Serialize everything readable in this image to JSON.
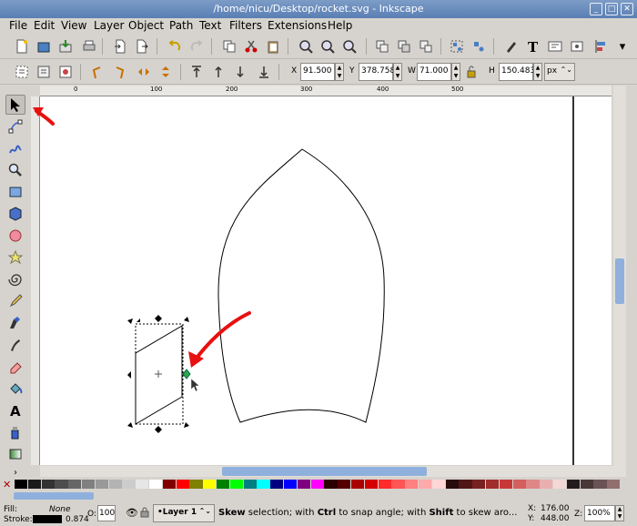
{
  "window": {
    "title": "/home/nicu/Desktop/rocket.svg - Inkscape"
  },
  "menu": [
    "File",
    "Edit",
    "View",
    "Layer",
    "Object",
    "Path",
    "Text",
    "Filters",
    "Extensions",
    "Help"
  ],
  "coords": {
    "x_label": "X",
    "x_value": "91.500",
    "y_label": "Y",
    "y_value": "378.758",
    "w_label": "W",
    "w_value": "71.000",
    "h_label": "H",
    "h_value": "150.483",
    "unit": "px"
  },
  "ruler": {
    "ticks": [
      "0",
      "100",
      "200",
      "300",
      "400",
      "500"
    ]
  },
  "palette": [
    "#000000",
    "#1a1a1a",
    "#333333",
    "#4d4d4d",
    "#666666",
    "#808080",
    "#999999",
    "#b3b3b3",
    "#cccccc",
    "#e6e6e6",
    "#ffffff",
    "#800000",
    "#ff0000",
    "#808000",
    "#ffff00",
    "#008000",
    "#00ff00",
    "#008080",
    "#00ffff",
    "#000080",
    "#0000ff",
    "#800080",
    "#ff00ff",
    "#2b0000",
    "#550000",
    "#aa0000",
    "#d40000",
    "#ff2a2a",
    "#ff5555",
    "#ff8080",
    "#ffaaaa",
    "#ffd5d5",
    "#280b0b",
    "#501616",
    "#782121",
    "#a02c2c",
    "#c83737",
    "#d35f5f",
    "#de8787",
    "#e9afaf",
    "#f4d7d7",
    "#241c1c",
    "#483737",
    "#6c5353",
    "#916f6f"
  ],
  "status": {
    "fill_label": "Fill:",
    "fill_value": "None",
    "stroke_label": "Stroke:",
    "stroke_width": "0.874",
    "opacity_label": "O:",
    "opacity_value": "100",
    "layer": "•Layer 1",
    "message_1": "Skew",
    "message_2": " selection; with ",
    "message_3": "Ctrl",
    "message_4": " to snap angle; with ",
    "message_5": "Shift",
    "message_6": " to skew aro...",
    "cursor_x_label": "X:",
    "cursor_x": "176.00",
    "cursor_y_label": "Y:",
    "cursor_y": "448.00",
    "zoom_label": "Z:",
    "zoom_value": "100%"
  }
}
